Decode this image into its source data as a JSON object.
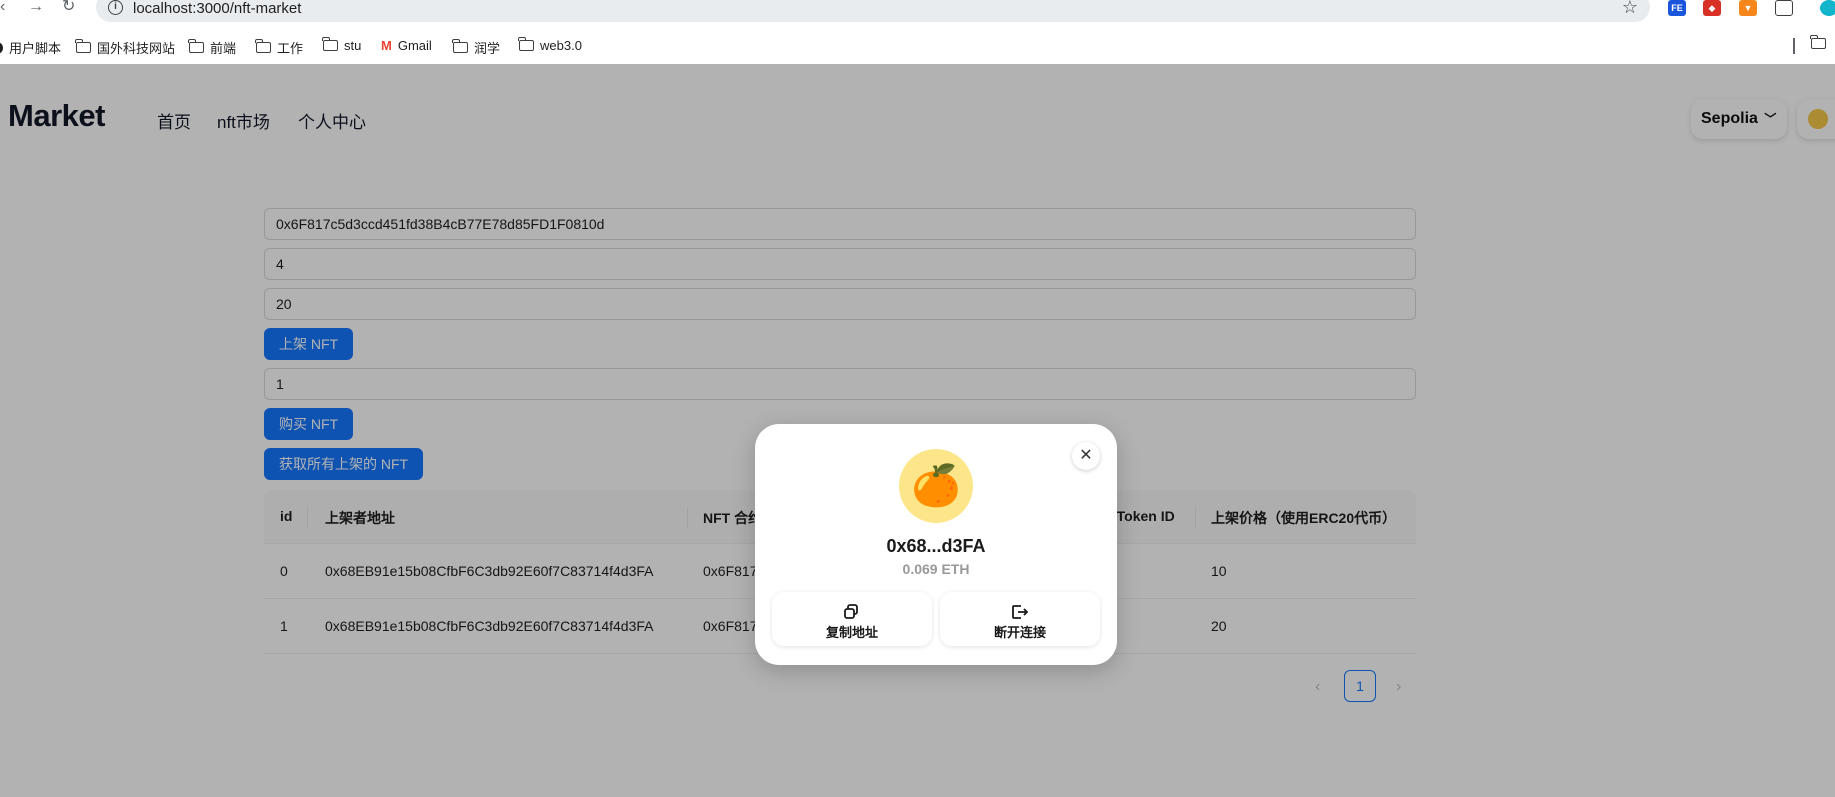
{
  "browser": {
    "url": "localhost:3000/nft-market",
    "bookmarks": [
      {
        "label": "用户脚本"
      },
      {
        "label": "国外科技网站"
      },
      {
        "label": "前端"
      },
      {
        "label": "工作"
      },
      {
        "label": "stu"
      },
      {
        "label": "Gmail"
      },
      {
        "label": "润学"
      },
      {
        "label": "web3.0"
      }
    ]
  },
  "header": {
    "brand": "Market",
    "nav": [
      "首页",
      "nft市场",
      "个人中心"
    ],
    "network": "Sepolia"
  },
  "form": {
    "nft_address": "0x6F817c5d3ccd451fd38B4cB77E78d85FD1F0810d",
    "token_id": "4",
    "price": "20",
    "list_button": "上架 NFT",
    "buy_id": "1",
    "buy_button": "购买 NFT",
    "fetch_button": "获取所有上架的 NFT"
  },
  "table": {
    "columns": [
      "id",
      "上架者地址",
      "NFT 合约",
      "tToken ID",
      "上架价格（使用ERC20代币）"
    ],
    "rows": [
      {
        "id": "0",
        "seller": "0x68EB91e15b08CfbF6C3db92E60f7C83714f4d3FA",
        "contract": "0x6F817",
        "price": "10"
      },
      {
        "id": "1",
        "seller": "0x68EB91e15b08CfbF6C3db92E60f7C83714f4d3FA",
        "contract": "0x6F817",
        "price": "20"
      }
    ]
  },
  "pagination": {
    "current": "1",
    "prev": "‹",
    "next": "›"
  },
  "modal": {
    "avatar": "🍊",
    "address": "0x68...d3FA",
    "balance": "0.069 ETH",
    "copy_label": "复制地址",
    "disconnect_label": "断开连接",
    "close": "✕"
  }
}
